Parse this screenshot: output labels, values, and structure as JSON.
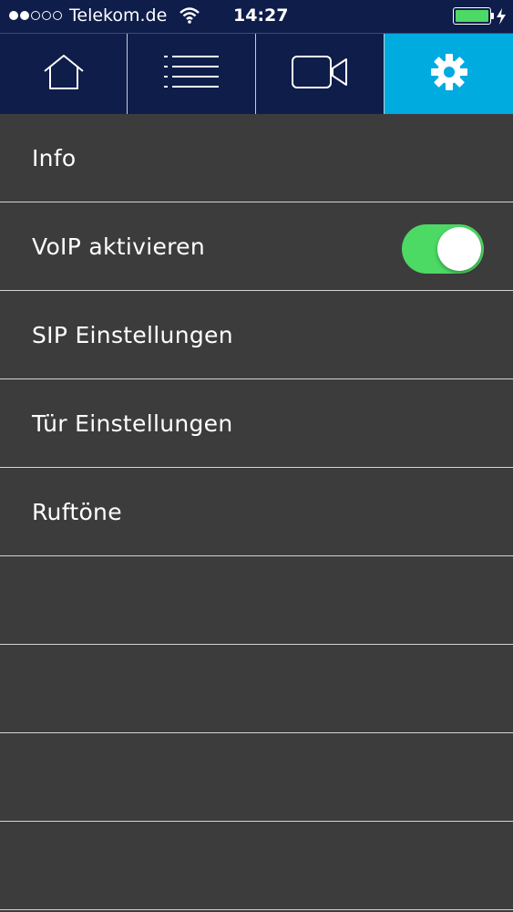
{
  "status_bar": {
    "carrier": "Telekom.de",
    "time": "14:27",
    "signal_bars_filled": 2,
    "signal_bars_total": 5,
    "battery_level": 1.0,
    "icons": [
      "wifi-icon",
      "battery-icon",
      "charging-bolt-icon"
    ]
  },
  "tab_bar": {
    "tabs": [
      {
        "icon": "home-icon",
        "active": false
      },
      {
        "icon": "list-icon",
        "active": false
      },
      {
        "icon": "video-camera-icon",
        "active": false
      },
      {
        "icon": "gear-icon",
        "active": true
      }
    ],
    "active_color": "#00abe0",
    "background_color": "#0e1d4a"
  },
  "settings": {
    "items": [
      {
        "label": "Info"
      },
      {
        "label": "VoIP aktivieren",
        "toggle": true
      },
      {
        "label": "SIP Einstellungen"
      },
      {
        "label": "Tür Einstellungen"
      },
      {
        "label": "Ruftöne"
      },
      {
        "label": ""
      },
      {
        "label": ""
      },
      {
        "label": ""
      },
      {
        "label": ""
      }
    ],
    "toggle_color": "#4cd964",
    "background_color": "#3d3c3d"
  }
}
